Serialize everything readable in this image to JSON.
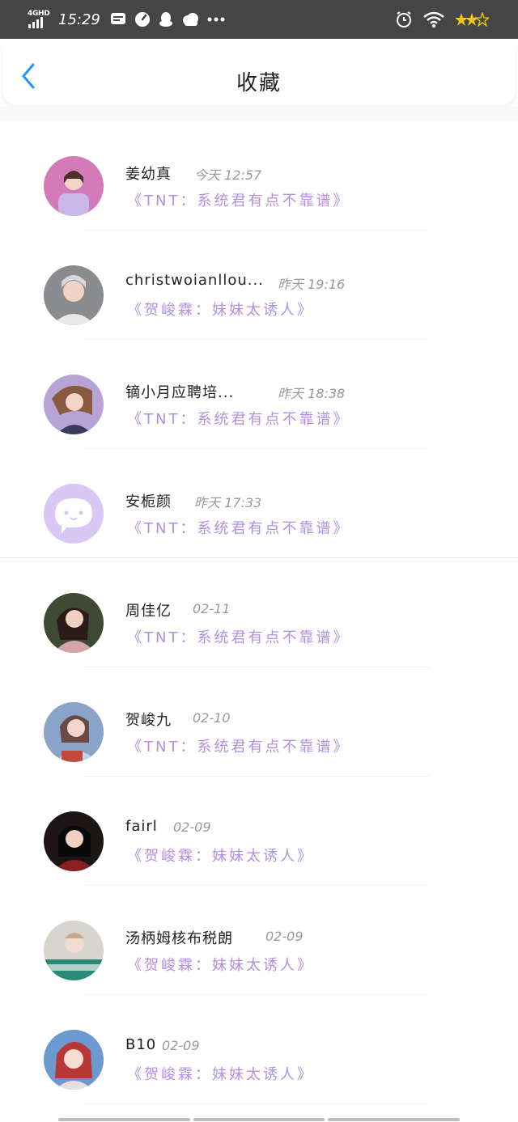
{
  "status_bar": {
    "network": "4GHD",
    "time": "15:29",
    "colors": {
      "bg": "#454545",
      "fg": "#ffffff",
      "stars": "#f5c518"
    }
  },
  "header": {
    "title": "收藏",
    "back_icon": "chevron-left-icon",
    "accent": "#2196f3"
  },
  "favorites": [
    {
      "name": "姜幼真",
      "time": "今天 12:57",
      "book": "《TNT：系统君有点不靠谱》",
      "avatar_color": "#d57ab8"
    },
    {
      "name": "christwoianllou...",
      "time": "昨天 19:16",
      "book": "《贺峻霖：妹妹太诱人》",
      "avatar_color": "#8a8c8f"
    },
    {
      "name": "镝小月应聘培...",
      "time": "昨天 18:38",
      "book": "《TNT：系统君有点不靠谱》",
      "avatar_color": "#b8a3d6"
    },
    {
      "name": "安栀颜",
      "time": "昨天 17:33",
      "book": "《TNT：系统君有点不靠谱》",
      "avatar_color": "#d9c7f5"
    },
    {
      "name": "周佳亿",
      "time": "02-11",
      "book": "《TNT：系统君有点不靠谱》",
      "avatar_color": "#9b8a86"
    },
    {
      "name": "贺峻九",
      "time": "02-10",
      "book": "《TNT：系统君有点不靠谱》",
      "avatar_color": "#8aa3c8"
    },
    {
      "name": "fairl",
      "time": "02-09",
      "book": "《贺峻霖：妹妹太诱人》",
      "avatar_color": "#5a2a2a"
    },
    {
      "name": "汤柄姆核布税朗",
      "time": "02-09",
      "book": "《贺峻霖：妹妹太诱人》",
      "avatar_color": "#d8d4cf"
    },
    {
      "name": "B10",
      "time": "02-09",
      "book": "《贺峻霖：妹妹太诱人》",
      "avatar_color": "#c85a55"
    }
  ],
  "colors": {
    "book_title": "#b48fe0",
    "time": "#9a9a9a",
    "name": "#222222"
  }
}
